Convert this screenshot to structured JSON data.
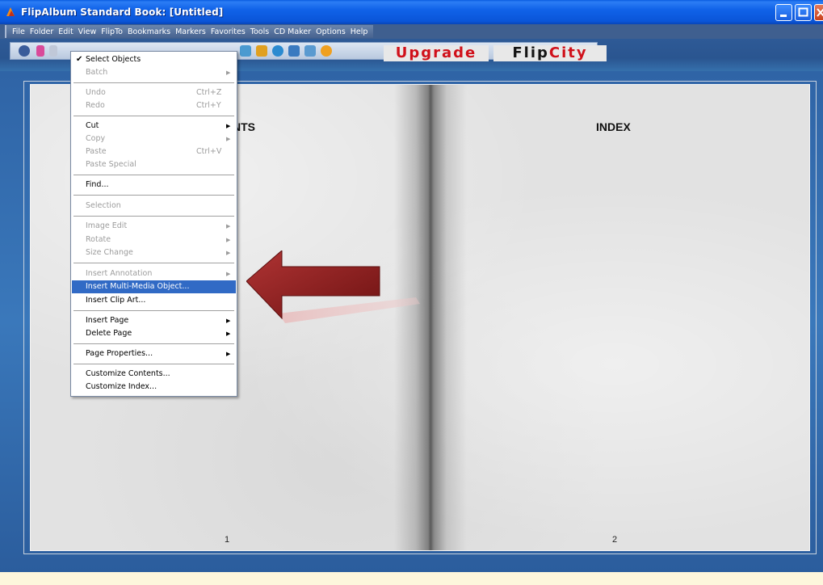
{
  "window": {
    "title": "FlipAlbum Standard   Book: [Untitled]"
  },
  "menubar": {
    "items": [
      "File",
      "Folder",
      "Edit",
      "View",
      "FlipTo",
      "Bookmarks",
      "Markers",
      "Favorites",
      "Tools",
      "CD Maker",
      "Options",
      "Help"
    ]
  },
  "toolbar": {
    "upgrade_label": "Upgrade",
    "flipcity_part1": "Flip",
    "flipcity_part2": "City"
  },
  "edit_menu": {
    "select_objects": "Select Objects",
    "batch": "Batch",
    "undo": "Undo",
    "undo_shortcut": "Ctrl+Z",
    "redo": "Redo",
    "redo_shortcut": "Ctrl+Y",
    "cut": "Cut",
    "copy": "Copy",
    "paste": "Paste",
    "paste_shortcut": "Ctrl+V",
    "paste_special": "Paste Special",
    "find": "Find...",
    "selection": "Selection",
    "image_edit": "Image Edit",
    "rotate": "Rotate",
    "size_change": "Size Change",
    "insert_annotation": "Insert Annotation",
    "insert_multimedia": "Insert Multi-Media Object...",
    "insert_clipart": "Insert Clip Art...",
    "insert_page": "Insert Page",
    "delete_page": "Delete Page",
    "page_properties": "Page Properties...",
    "customize_contents": "Customize Contents...",
    "customize_index": "Customize Index..."
  },
  "book": {
    "left_title": "NTS",
    "right_title": "INDEX",
    "left_page_number": "1",
    "right_page_number": "2"
  },
  "colors": {
    "menu_highlight": "#316ac5",
    "arrow": "#8a1c1c",
    "upgrade_text": "#d0101a"
  }
}
